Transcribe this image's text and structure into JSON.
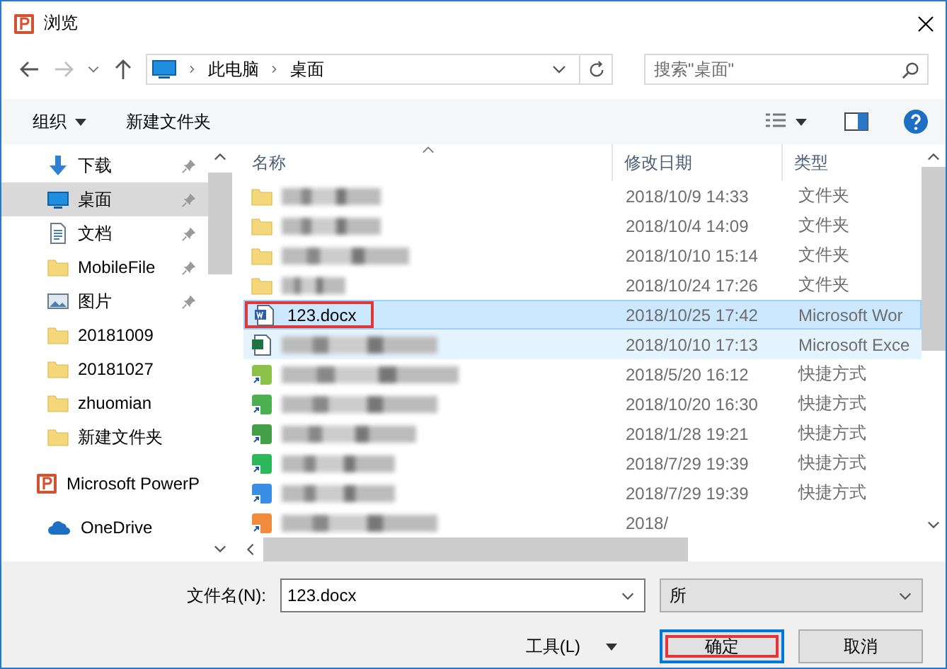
{
  "window": {
    "title": "浏览"
  },
  "address": {
    "crumbs": [
      "此电脑",
      "桌面"
    ]
  },
  "search": {
    "placeholder": "搜索\"桌面\""
  },
  "toolbar": {
    "organize": "组织",
    "new_folder": "新建文件夹"
  },
  "nav": {
    "items": [
      {
        "label": "下载",
        "kind": "download",
        "pinned": true,
        "selected": false
      },
      {
        "label": "桌面",
        "kind": "desktop",
        "pinned": true,
        "selected": true
      },
      {
        "label": "文档",
        "kind": "document",
        "pinned": true,
        "selected": false
      },
      {
        "label": "MobileFile",
        "kind": "folder",
        "pinned": true,
        "selected": false
      },
      {
        "label": "图片",
        "kind": "pictures",
        "pinned": true,
        "selected": false
      },
      {
        "label": "20181009",
        "kind": "folder",
        "pinned": false,
        "selected": false
      },
      {
        "label": "20181027",
        "kind": "folder",
        "pinned": false,
        "selected": false
      },
      {
        "label": "zhuomian",
        "kind": "folder",
        "pinned": false,
        "selected": false
      },
      {
        "label": "新建文件夹",
        "kind": "folder",
        "pinned": false,
        "selected": false
      },
      {
        "label": "Microsoft PowerP",
        "kind": "app",
        "pinned": false,
        "selected": false
      },
      {
        "label": "OneDrive",
        "kind": "cloud",
        "pinned": false,
        "selected": false
      }
    ]
  },
  "file_list": {
    "columns": [
      "名称",
      "修改日期",
      "类型"
    ],
    "rows": [
      {
        "kind": "folder",
        "date": "2018/10/9 14:33",
        "type": "文件夹",
        "selected": false,
        "hovered": false,
        "annotated": false
      },
      {
        "kind": "folder",
        "date": "2018/10/4 14:09",
        "type": "文件夹",
        "selected": false,
        "hovered": false,
        "annotated": false
      },
      {
        "kind": "folder",
        "date": "2018/10/10 15:14",
        "type": "文件夹",
        "selected": false,
        "hovered": false,
        "annotated": false
      },
      {
        "kind": "folder",
        "date": "2018/10/24 17:26",
        "type": "文件夹",
        "selected": false,
        "hovered": false,
        "annotated": false
      },
      {
        "kind": "word",
        "name": "123.docx",
        "date": "2018/10/25 17:42",
        "type": "Microsoft Wor",
        "selected": true,
        "hovered": false,
        "annotated": true
      },
      {
        "kind": "excel",
        "date": "2018/10/10 17:13",
        "type": "Microsoft Exce",
        "selected": false,
        "hovered": true,
        "annotated": false
      },
      {
        "kind": "shortcut",
        "color": "#8bc34a",
        "date": "2018/5/20 16:12",
        "type": "快捷方式",
        "selected": false,
        "hovered": false,
        "annotated": false
      },
      {
        "kind": "shortcut",
        "color": "#4caf50",
        "date": "2018/10/20 16:30",
        "type": "快捷方式",
        "selected": false,
        "hovered": false,
        "annotated": false
      },
      {
        "kind": "shortcut",
        "color": "#43a047",
        "date": "2018/1/28 19:21",
        "type": "快捷方式",
        "selected": false,
        "hovered": false,
        "annotated": false
      },
      {
        "kind": "shortcut",
        "color": "#2eb85c",
        "date": "2018/7/29 19:39",
        "type": "快捷方式",
        "selected": false,
        "hovered": false,
        "annotated": false
      },
      {
        "kind": "shortcut",
        "color": "#3a8ee6",
        "date": "2018/7/29 19:39",
        "type": "快捷方式",
        "selected": false,
        "hovered": false,
        "annotated": false
      },
      {
        "kind": "shortcut",
        "color": "#f08a3c",
        "date": "2018/",
        "selected": false,
        "hovered": false,
        "annotated": false
      }
    ]
  },
  "footer": {
    "filename_label": "文件名(N):",
    "filename": "123.docx",
    "filter": "所",
    "tools": "工具(L)",
    "buttons": [
      {
        "label": "确定",
        "default": true,
        "annotated": true
      },
      {
        "label": "取消",
        "default": false,
        "annotated": false
      }
    ]
  }
}
